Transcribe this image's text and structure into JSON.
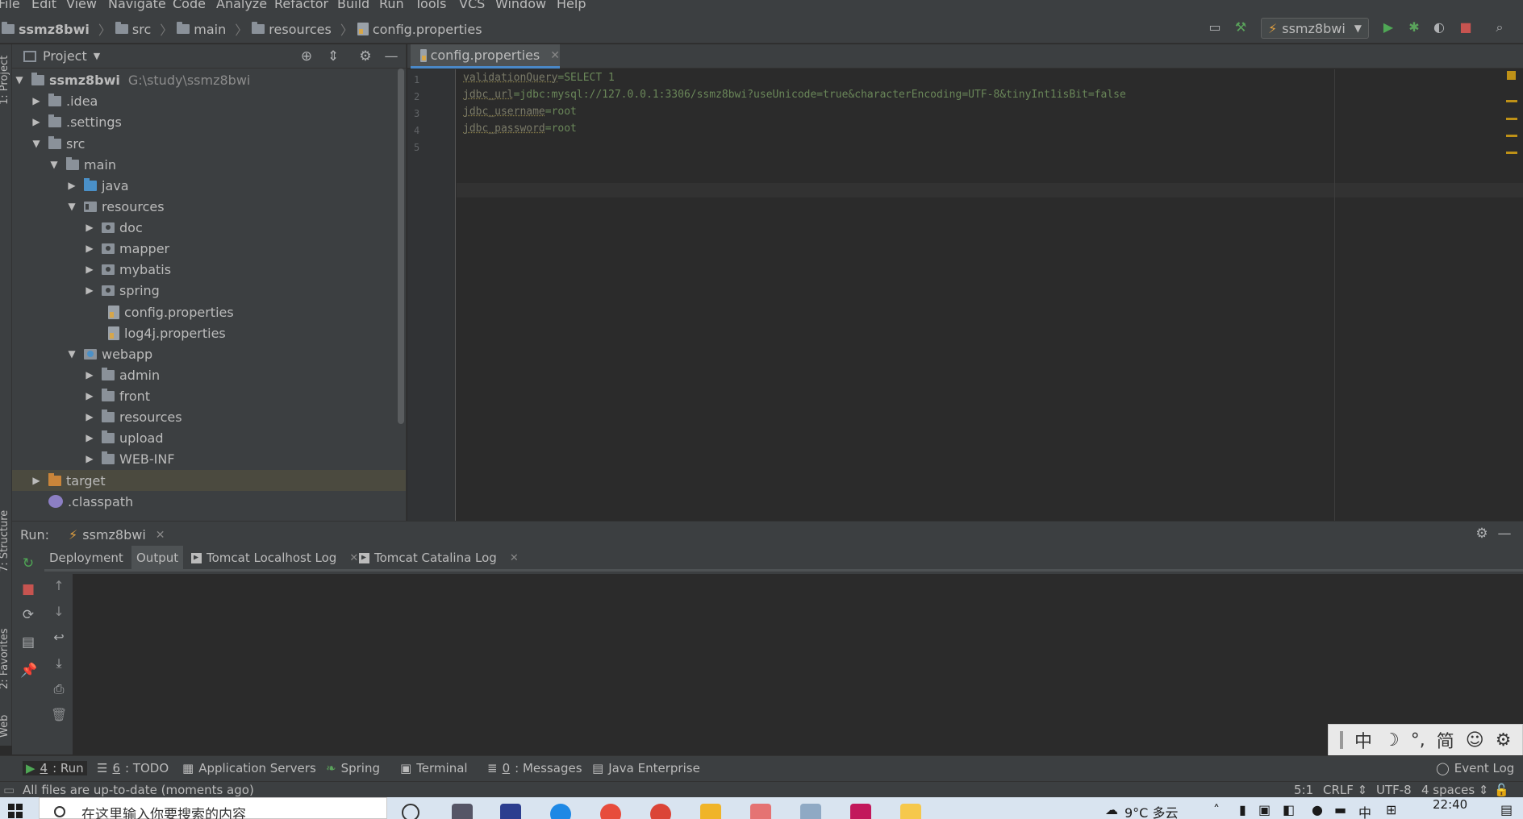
{
  "menu": [
    "File",
    "Edit",
    "View",
    "Navigate",
    "Code",
    "Analyze",
    "Refactor",
    "Build",
    "Run",
    "Tools",
    "VCS",
    "Window",
    "Help"
  ],
  "breadcrumb": [
    "ssmz8bwi",
    "src",
    "main",
    "resources",
    "config.properties"
  ],
  "toolbar": {
    "run_config": "ssmz8bwi"
  },
  "project": {
    "title": "Project",
    "tree": [
      {
        "label": "ssmz8bwi",
        "sub": "G:\\study\\ssmz8bwi"
      },
      {
        "label": ".idea"
      },
      {
        "label": ".settings"
      },
      {
        "label": "src"
      },
      {
        "label": "main"
      },
      {
        "label": "java"
      },
      {
        "label": "resources"
      },
      {
        "label": "doc"
      },
      {
        "label": "mapper"
      },
      {
        "label": "mybatis"
      },
      {
        "label": "spring"
      },
      {
        "label": "config.properties"
      },
      {
        "label": "log4j.properties"
      },
      {
        "label": "webapp"
      },
      {
        "label": "admin"
      },
      {
        "label": "front"
      },
      {
        "label": "resources"
      },
      {
        "label": "upload"
      },
      {
        "label": "WEB-INF"
      },
      {
        "label": "target"
      },
      {
        "label": ".classpath"
      }
    ]
  },
  "editor": {
    "tab": "config.properties",
    "lines": [
      {
        "num": "1",
        "key": "validationQuery",
        "value": "SELECT 1"
      },
      {
        "num": "2",
        "key": "jdbc_url",
        "value": "jdbc:mysql://127.0.0.1:3306/ssmz8bwi?useUnicode=true&characterEncoding=UTF-8&tinyInt1isBit=false"
      },
      {
        "num": "3",
        "key": "jdbc_username",
        "value": "root"
      },
      {
        "num": "4",
        "key": "jdbc_password",
        "value": "root"
      },
      {
        "num": "5",
        "key": "",
        "value": ""
      }
    ]
  },
  "run": {
    "label": "Run:",
    "config": "ssmz8bwi",
    "subtabs": [
      "Deployment",
      "Output",
      "Tomcat Localhost Log",
      "Tomcat Catalina Log"
    ]
  },
  "ime": [
    "中",
    "☽",
    "°,",
    "简",
    "☺",
    "⚙"
  ],
  "bottom_tabs": [
    {
      "num": "4",
      "label": ": Run"
    },
    {
      "num": "6",
      "label": ": TODO"
    },
    {
      "num": "",
      "label": "Application Servers"
    },
    {
      "num": "",
      "label": "Spring"
    },
    {
      "num": "",
      "label": "Terminal"
    },
    {
      "num": "0",
      "label": ": Messages"
    },
    {
      "num": "",
      "label": "Java Enterprise"
    },
    {
      "num": "",
      "label": "Event Log"
    }
  ],
  "left_strip": [
    "1: Project",
    "7: Structure",
    "2: Favorites",
    "Web"
  ],
  "status": {
    "message": "All files are up-to-date (moments ago)",
    "position": "5:1",
    "line_sep": "CRLF",
    "encoding": "UTF-8",
    "indent": "4 spaces"
  },
  "taskbar": {
    "search_placeholder": "在这里输入你要搜索的内容",
    "weather": "9°C 多云",
    "time": "22:40",
    "tray_ime": "中"
  }
}
